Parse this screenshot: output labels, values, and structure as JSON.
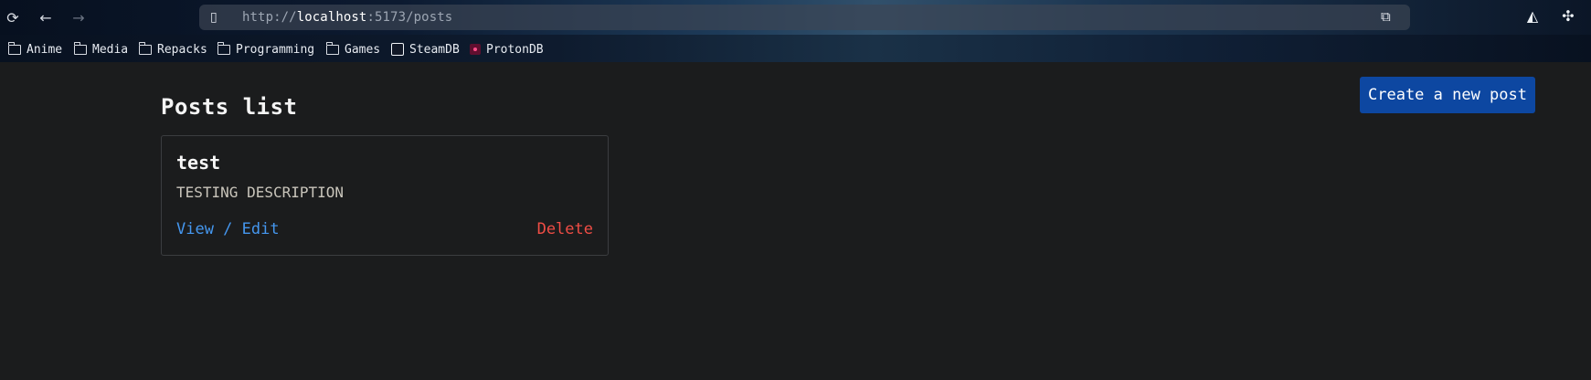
{
  "browser": {
    "url_prefix": "http://",
    "url_host": "localhost",
    "url_suffix": ":5173/posts",
    "icons": {
      "reload": "⟳",
      "back": "←",
      "forward": "→",
      "page": "▯",
      "reader": "⧉",
      "account": "◭",
      "extensions": "✣"
    }
  },
  "bookmarks": [
    {
      "label": "Anime",
      "icon": "folder-icon"
    },
    {
      "label": "Media",
      "icon": "folder-icon"
    },
    {
      "label": "Repacks",
      "icon": "folder-icon"
    },
    {
      "label": "Programming",
      "icon": "folder-icon"
    },
    {
      "label": "Games",
      "icon": "folder-icon"
    },
    {
      "label": "SteamDB",
      "icon": "steamdb-icon"
    },
    {
      "label": "ProtonDB",
      "icon": "protondb-icon"
    }
  ],
  "page": {
    "title": "Posts list",
    "create_label": "Create a new post"
  },
  "posts": [
    {
      "title": "test",
      "description": "TESTING DESCRIPTION",
      "view_label": "View / Edit",
      "delete_label": "Delete"
    }
  ],
  "colors": {
    "background": "#1b1c1d",
    "primary_button": "#0d47a1",
    "link": "#4597ef",
    "danger": "#f04d45",
    "card_border": "#3b3d40"
  }
}
